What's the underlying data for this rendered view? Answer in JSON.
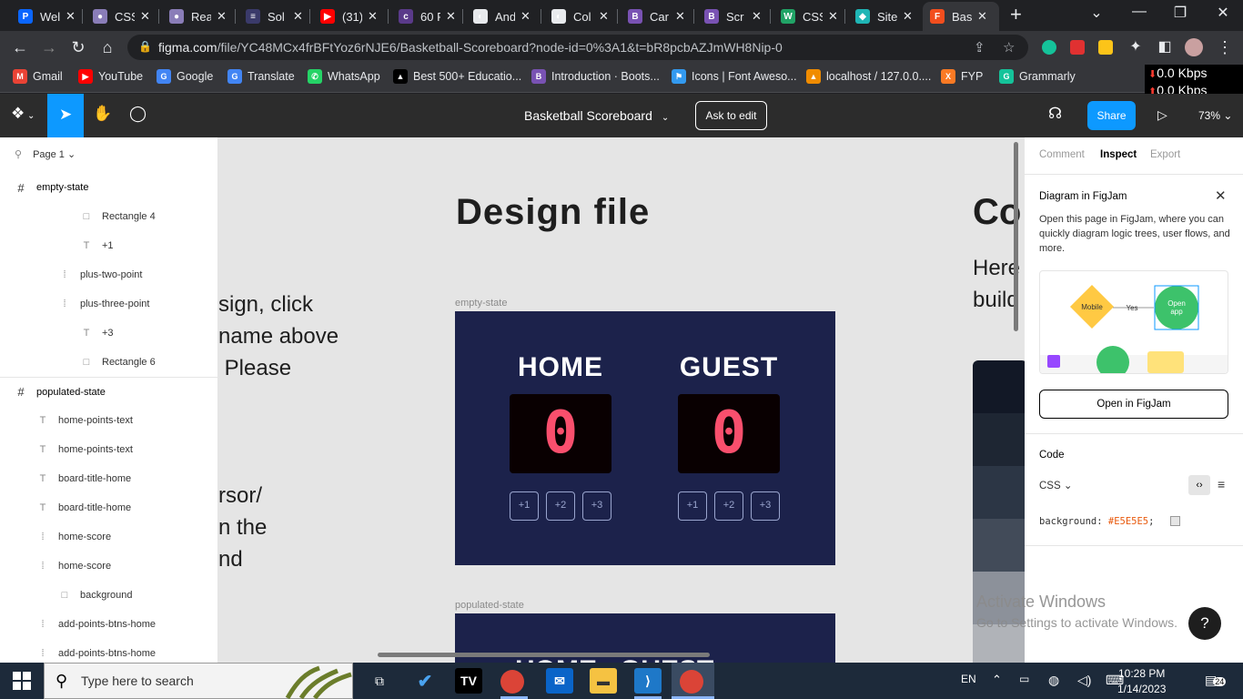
{
  "browser": {
    "tabs": [
      {
        "icon": "P",
        "color": "#0a66ff",
        "label": "Wel"
      },
      {
        "icon": "●",
        "color": "#8a7db8",
        "label": "CSS"
      },
      {
        "icon": "●",
        "color": "#8a7db8",
        "label": "Rea"
      },
      {
        "icon": "≡",
        "color": "#3a3a6a",
        "label": "Sol"
      },
      {
        "icon": "▶",
        "color": "#ff0000",
        "label": "(31)"
      },
      {
        "icon": "c",
        "color": "#5a3a8a",
        "label": "60 F"
      },
      {
        "icon": "◐",
        "color": "#e8eaed",
        "label": "And"
      },
      {
        "icon": "◐",
        "color": "#e8eaed",
        "label": "Col"
      },
      {
        "icon": "B",
        "color": "#7952b3",
        "label": "Car"
      },
      {
        "icon": "B",
        "color": "#7952b3",
        "label": "Scr"
      },
      {
        "icon": "W",
        "color": "#21a366",
        "label": "CSS"
      },
      {
        "icon": "◆",
        "color": "#1fb5b5",
        "label": "Site"
      },
      {
        "icon": "F",
        "color": "#f24e1e",
        "label": "Bas"
      }
    ],
    "url_host": "figma.com",
    "url_path": "/file/YC48MCx4frBFtYoz6rNJE6/Basketball-Scoreboard?node-id=0%3A1&t=bR8pcbAZJmWH8Nip-0",
    "bookmarks": [
      {
        "icon": "M",
        "color": "#ea4335",
        "label": "Gmail"
      },
      {
        "icon": "▶",
        "color": "#ff0000",
        "label": "YouTube"
      },
      {
        "icon": "G",
        "color": "#4285f4",
        "label": "Google"
      },
      {
        "icon": "G",
        "color": "#4285f4",
        "label": "Translate"
      },
      {
        "icon": "✆",
        "color": "#25d366",
        "label": "WhatsApp"
      },
      {
        "icon": "▲",
        "color": "#000000",
        "label": "Best 500+ Educatio..."
      },
      {
        "icon": "B",
        "color": "#7952b3",
        "label": "Introduction · Boots..."
      },
      {
        "icon": "⚑",
        "color": "#339af0",
        "label": "Icons | Font Aweso..."
      },
      {
        "icon": "▲",
        "color": "#f08c00",
        "label": "localhost / 127.0.0...."
      },
      {
        "icon": "X",
        "color": "#fb7a24",
        "label": "FYP"
      },
      {
        "icon": "G",
        "color": "#15c39a",
        "label": "Grammarly"
      }
    ],
    "net_down": "0.0 Kbps",
    "net_up": "0.0 Kbps"
  },
  "figma": {
    "file_title": "Basketball Scoreboard",
    "ask_label": "Ask to edit",
    "share_label": "Share",
    "zoom": "73%",
    "page": "Page 1",
    "layers": [
      {
        "icon": "#",
        "label": "empty-state",
        "indent": 0
      },
      {
        "icon": "□",
        "label": "Rectangle 4",
        "indent": 3
      },
      {
        "icon": "T",
        "label": "+1",
        "indent": 3
      },
      {
        "icon": "⁞",
        "label": "plus-two-point",
        "indent": 2
      },
      {
        "icon": "⁞",
        "label": "plus-three-point",
        "indent": 2
      },
      {
        "icon": "T",
        "label": "+3",
        "indent": 3
      },
      {
        "icon": "□",
        "label": "Rectangle 6",
        "indent": 3
      },
      {
        "icon": "#",
        "label": "populated-state",
        "indent": 0
      },
      {
        "icon": "T",
        "label": "home-points-text",
        "indent": 1
      },
      {
        "icon": "T",
        "label": "home-points-text",
        "indent": 1
      },
      {
        "icon": "T",
        "label": "board-title-home",
        "indent": 1
      },
      {
        "icon": "T",
        "label": "board-title-home",
        "indent": 1
      },
      {
        "icon": "⁞",
        "label": "home-score",
        "indent": 1
      },
      {
        "icon": "⁞",
        "label": "home-score",
        "indent": 1
      },
      {
        "icon": "□",
        "label": "background",
        "indent": 2
      },
      {
        "icon": "⁞",
        "label": "add-points-btns-home",
        "indent": 1
      },
      {
        "icon": "⁞",
        "label": "add-points-btns-home",
        "indent": 1
      }
    ],
    "canvas": {
      "design_title": "Design file",
      "other_title": "Co",
      "side_lines_1": [
        "sign, click",
        "name above",
        " Please"
      ],
      "side_lines_2": [
        "rsor/",
        "n the",
        "nd"
      ],
      "right_lines": [
        "Here",
        "build"
      ],
      "frame1_label": "empty-state",
      "frame2_label": "populated-state",
      "home_label": "HOME",
      "guest_label": "GUEST",
      "home_score": "0",
      "guest_score": "0",
      "buttons": [
        "+1",
        "+2",
        "+3"
      ],
      "frame2_text": "HOME   GUEST"
    },
    "inspect": {
      "tabs": [
        "Comment",
        "Inspect",
        "Export"
      ],
      "diagram_title": "Diagram in FigJam",
      "diagram_desc": "Open this page in FigJam, where you can quickly diagram logic trees, user flows, and more.",
      "preview_mobile": "Mobile",
      "preview_yes": "Yes",
      "preview_open": "Open app",
      "open_btn": "Open in FigJam",
      "code_title": "Code",
      "code_lang": "CSS",
      "code_prop": "background:",
      "code_value": "#E5E5E5",
      "code_end": ";"
    },
    "activate_title": "Activate Windows",
    "activate_sub": "Go to Settings to activate Windows."
  },
  "taskbar": {
    "search_placeholder": "Type here to search",
    "lang": "EN",
    "time": "10:28 PM",
    "date": "1/14/2023",
    "notif_count": "24"
  }
}
